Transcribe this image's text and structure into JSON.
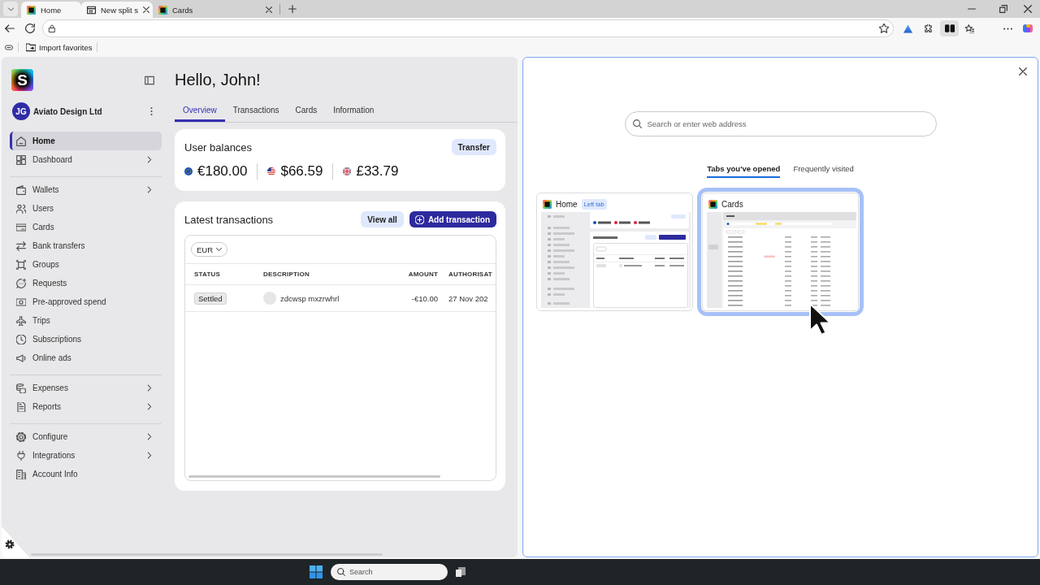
{
  "browser": {
    "tabs": [
      {
        "kind": "site",
        "title": "Home",
        "selected": true,
        "closable": false
      },
      {
        "kind": "new_tab",
        "title": "New split s",
        "selected": true,
        "closable": true
      },
      {
        "kind": "site",
        "title": "Cards",
        "selected": false,
        "closable": true
      }
    ],
    "split_view_button": {
      "selected": true
    },
    "favorites_bar": {
      "items": [
        {
          "label": "Import favorites"
        }
      ]
    }
  },
  "app": {
    "logo": "S",
    "organization": {
      "initials": "JG",
      "name": "Aviato Design Ltd"
    },
    "sidebar": {
      "sections": [
        {
          "items": [
            {
              "label": "Home",
              "selected": true,
              "has_submenu": false
            },
            {
              "label": "Dashboard",
              "selected": false,
              "has_submenu": true
            }
          ]
        },
        {
          "items": [
            {
              "label": "Wallets",
              "selected": false,
              "has_submenu": true
            },
            {
              "label": "Users",
              "selected": false,
              "has_submenu": false
            },
            {
              "label": "Cards",
              "selected": false,
              "has_submenu": false
            },
            {
              "label": "Bank transfers",
              "selected": false,
              "has_submenu": false
            },
            {
              "label": "Groups",
              "selected": false,
              "has_submenu": false
            },
            {
              "label": "Requests",
              "selected": false,
              "has_submenu": false
            },
            {
              "label": "Pre-approved spend",
              "selected": false,
              "has_submenu": false
            },
            {
              "label": "Trips",
              "selected": false,
              "has_submenu": false
            },
            {
              "label": "Subscriptions",
              "selected": false,
              "has_submenu": false
            },
            {
              "label": "Online ads",
              "selected": false,
              "has_submenu": false
            }
          ]
        },
        {
          "items": [
            {
              "label": "Expenses",
              "selected": false,
              "has_submenu": true
            },
            {
              "label": "Reports",
              "selected": false,
              "has_submenu": true
            }
          ]
        },
        {
          "items": [
            {
              "label": "Configure",
              "selected": false,
              "has_submenu": true
            },
            {
              "label": "Integrations",
              "selected": false,
              "has_submenu": true
            },
            {
              "label": "Account Info",
              "selected": false,
              "has_submenu": false
            }
          ]
        }
      ]
    },
    "greeting": "Hello, John!",
    "tabs": [
      {
        "label": "Overview",
        "selected": true
      },
      {
        "label": "Transactions",
        "selected": false
      },
      {
        "label": "Cards",
        "selected": false
      },
      {
        "label": "Information",
        "selected": false
      }
    ],
    "balances_card": {
      "title": "User balances",
      "button": "Transfer",
      "balances": [
        "€180.00",
        "$66.59",
        "£33.79"
      ]
    },
    "transactions_card": {
      "title": "Latest transactions",
      "buttons": [
        {
          "kind": "secondary",
          "label": "View all"
        },
        {
          "kind": "primary",
          "label": "Add transaction"
        }
      ],
      "currency_select": {
        "value": "EUR"
      },
      "table": {
        "columns": [
          "STATUS",
          "DESCRIPTION",
          "AMOUNT",
          "AUTHORISAT"
        ],
        "rows": [
          {
            "cells": [
              "Settled",
              "zdcwsp mxzrwhrl",
              "-€10.00",
              "27 Nov 202"
            ]
          }
        ]
      }
    }
  },
  "new_tab_page": {
    "search": {
      "placeholder": "Search or enter web address"
    },
    "tabs": [
      {
        "label": "Tabs you've opened",
        "selected": true
      },
      {
        "label": "Frequently visited",
        "selected": false
      }
    ],
    "tab_cards": [
      {
        "title": "Home",
        "badge": "Left tab",
        "selected": false
      },
      {
        "title": "Cards",
        "selected": true
      }
    ]
  },
  "taskbar": {
    "search": {
      "placeholder": "Search"
    }
  }
}
